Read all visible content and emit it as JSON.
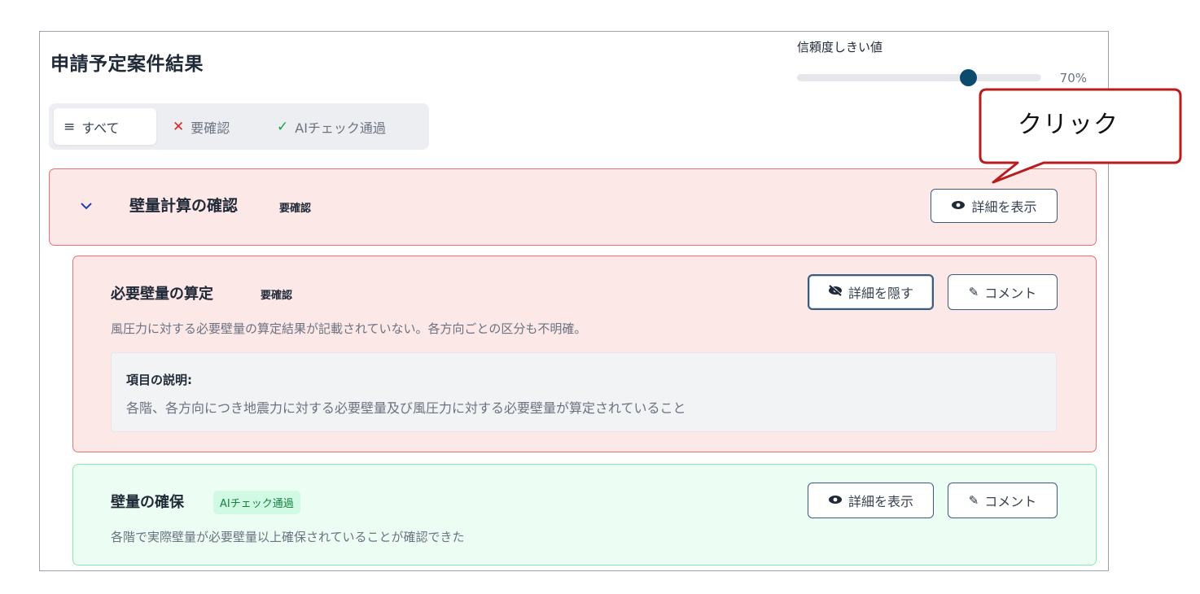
{
  "page": {
    "title": "申請予定案件結果"
  },
  "threshold": {
    "label": "信頼度しきい値",
    "value": 0.7,
    "value_text": "70%",
    "accent_color": "#0c4a6e"
  },
  "filters": {
    "tabs": [
      {
        "icon": "list-icon",
        "icon_glyph": "≡",
        "label": "すべて",
        "active": true
      },
      {
        "icon": "x-icon",
        "icon_glyph": "✕",
        "label": "要確認",
        "active": false
      },
      {
        "icon": "check-icon",
        "icon_glyph": "✓",
        "label": "AIチェック通過",
        "active": false
      }
    ]
  },
  "section": {
    "chevron_icon": "chevron-down-icon",
    "chevron_glyph": "⌄",
    "title": "壁量計算の確認",
    "badge": "要確認",
    "detail_button": {
      "icon": "eye-icon",
      "label": "詳細を表示"
    }
  },
  "items": [
    {
      "title": "必要壁量の算定",
      "badge": "要確認",
      "status": "review",
      "description": "風圧力に対する必要壁量の算定結果が記載されていない。各方向ごとの区分も不明確。",
      "detail_button": {
        "icon": "eye-off-icon",
        "label": "詳細を隠す"
      },
      "comment_button": {
        "icon": "pencil-icon",
        "glyph": "✎",
        "label": "コメント"
      },
      "explanation": {
        "label": "項目の説明:",
        "text": "各階、各方向につき地震力に対する必要壁量及び風圧力に対する必要壁量が算定されていること"
      }
    },
    {
      "title": "壁量の確保",
      "badge": "AIチェック通過",
      "status": "pass",
      "description": "各階で実際壁量が必要壁量以上確保されていることが確認できた",
      "detail_button": {
        "icon": "eye-icon",
        "label": "詳細を表示"
      },
      "comment_button": {
        "icon": "pencil-icon",
        "glyph": "✎",
        "label": "コメント"
      }
    }
  ],
  "annotation": {
    "callout_text": "クリック",
    "callout_color": "#b91c1c"
  },
  "colors": {
    "review_bg": "#fde8e8",
    "review_border": "#e57373",
    "pass_bg": "#ecfdf3",
    "pass_border": "#86efac",
    "button_border": "#3b5b7a"
  }
}
